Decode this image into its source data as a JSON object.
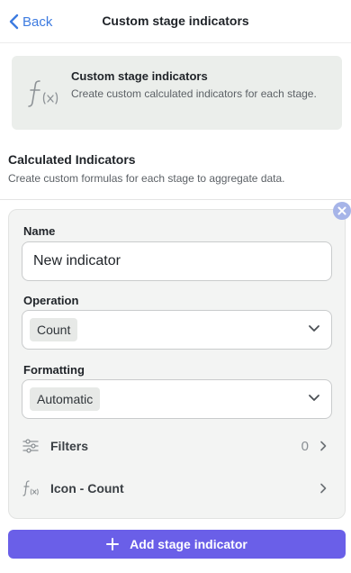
{
  "header": {
    "back_label": "Back",
    "title": "Custom stage indicators"
  },
  "info_card": {
    "icon": "function-icon",
    "title": "Custom stage indicators",
    "description": "Create custom calculated indicators for each stage."
  },
  "section": {
    "title": "Calculated Indicators",
    "description": "Create custom formulas for each stage to aggregate data."
  },
  "indicator": {
    "name_label": "Name",
    "name_value": "New indicator",
    "operation_label": "Operation",
    "operation_value": "Count",
    "formatting_label": "Formatting",
    "formatting_value": "Automatic",
    "filters_label": "Filters",
    "filters_count": "0",
    "icon_row_label": "Icon - Count"
  },
  "footer": {
    "add_label": "Add stage indicator"
  },
  "colors": {
    "accent": "#3d7be0",
    "primary_button": "#6a5fe8",
    "remove_badge": "#a6b4e8"
  }
}
